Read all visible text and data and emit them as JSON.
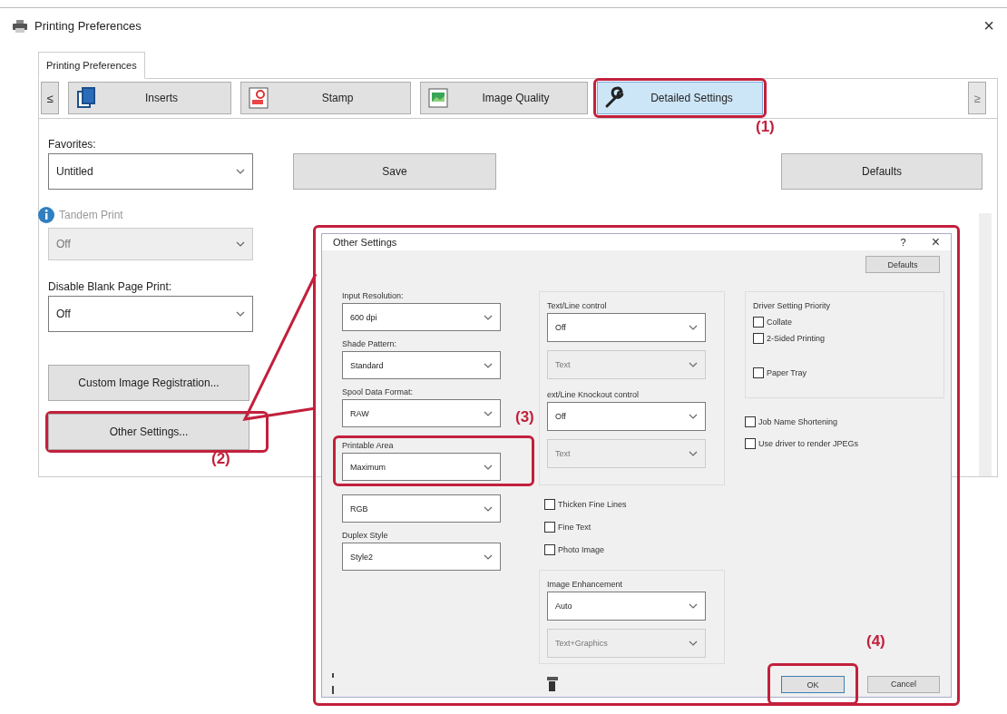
{
  "window": {
    "title": "Printing Preferences",
    "close": "×"
  },
  "page_tab": {
    "label": "Printing Preferences",
    "selected": true
  },
  "nav": {
    "prev": "≤",
    "next": "≥",
    "next_disabled": true
  },
  "tabs": [
    {
      "label": "Inserts",
      "kind": "pages",
      "selected": false,
      "highlighted": false
    },
    {
      "label": "Stamp",
      "kind": "stamp",
      "selected": false,
      "highlighted": false
    },
    {
      "label": "Image Quality",
      "kind": "image",
      "selected": false,
      "highlighted": false
    },
    {
      "label": "Detailed Settings",
      "kind": "wrench",
      "selected": true,
      "highlighted": true
    }
  ],
  "favorites": {
    "label": "Favorites:",
    "value": "Untitled"
  },
  "save_button": "Save",
  "defaults_button": "Defaults",
  "tandem_print": {
    "label": "Tandem Print",
    "value": "Off",
    "disabled": true
  },
  "disable_blank": {
    "label": "Disable Blank Page Print:",
    "value": "Off",
    "disabled": false
  },
  "side_buttons": [
    {
      "label": "Custom Image Registration...",
      "highlighted": false
    },
    {
      "label": "Other Settings...",
      "highlighted": true
    }
  ],
  "dialog": {
    "title": "Other Settings",
    "help": "?",
    "close": "×",
    "defaults": "Defaults",
    "highlighted": true,
    "left_fields": [
      {
        "label": "Input Resolution:",
        "value": "600 dpi",
        "highlighted": false
      },
      {
        "label": "Shade Pattern:",
        "value": "Standard",
        "highlighted": false
      },
      {
        "label": "Spool Data Format:",
        "value": "RAW",
        "highlighted": false
      },
      {
        "label": "Printable Area",
        "value": "Maximum",
        "highlighted": true
      },
      {
        "value": "RGB",
        "highlighted": false
      },
      {
        "label": "Duplex Style",
        "value": "Style2",
        "highlighted": false
      }
    ],
    "line_group": [
      {
        "label": "Text/Line control",
        "value": "Off",
        "sub": {
          "value": "Text",
          "disabled": true
        }
      },
      {
        "label": "ext/Line Knockout control",
        "value": "Off",
        "sub": {
          "value": "Text",
          "disabled": true
        }
      }
    ],
    "mid_checks": [
      {
        "label": "Thicken Fine Lines",
        "checked": false
      },
      {
        "label": "Fine Text",
        "checked": false
      },
      {
        "label": "Photo Image",
        "checked": false
      }
    ],
    "enhancement": {
      "label": "Image Enhancement",
      "value": "Auto",
      "sub": {
        "value": "Text+Graphics",
        "disabled": true
      }
    },
    "priority": {
      "label": "Driver Setting Priority",
      "items": [
        {
          "label": "Collate",
          "checked": false
        },
        {
          "label": "2-Sided Printing",
          "checked": false
        },
        {
          "label": "Paper Tray",
          "checked": false
        }
      ]
    },
    "right_checks": [
      {
        "label": "Job Name Shortening",
        "checked": false
      },
      {
        "label": "Use driver to render JPEGs",
        "checked": false
      }
    ],
    "ok": {
      "label": "OK",
      "highlighted": true
    },
    "cancel": "Cancel"
  },
  "markers": [
    "(1)",
    "(2)",
    "(3)",
    "(4)"
  ]
}
